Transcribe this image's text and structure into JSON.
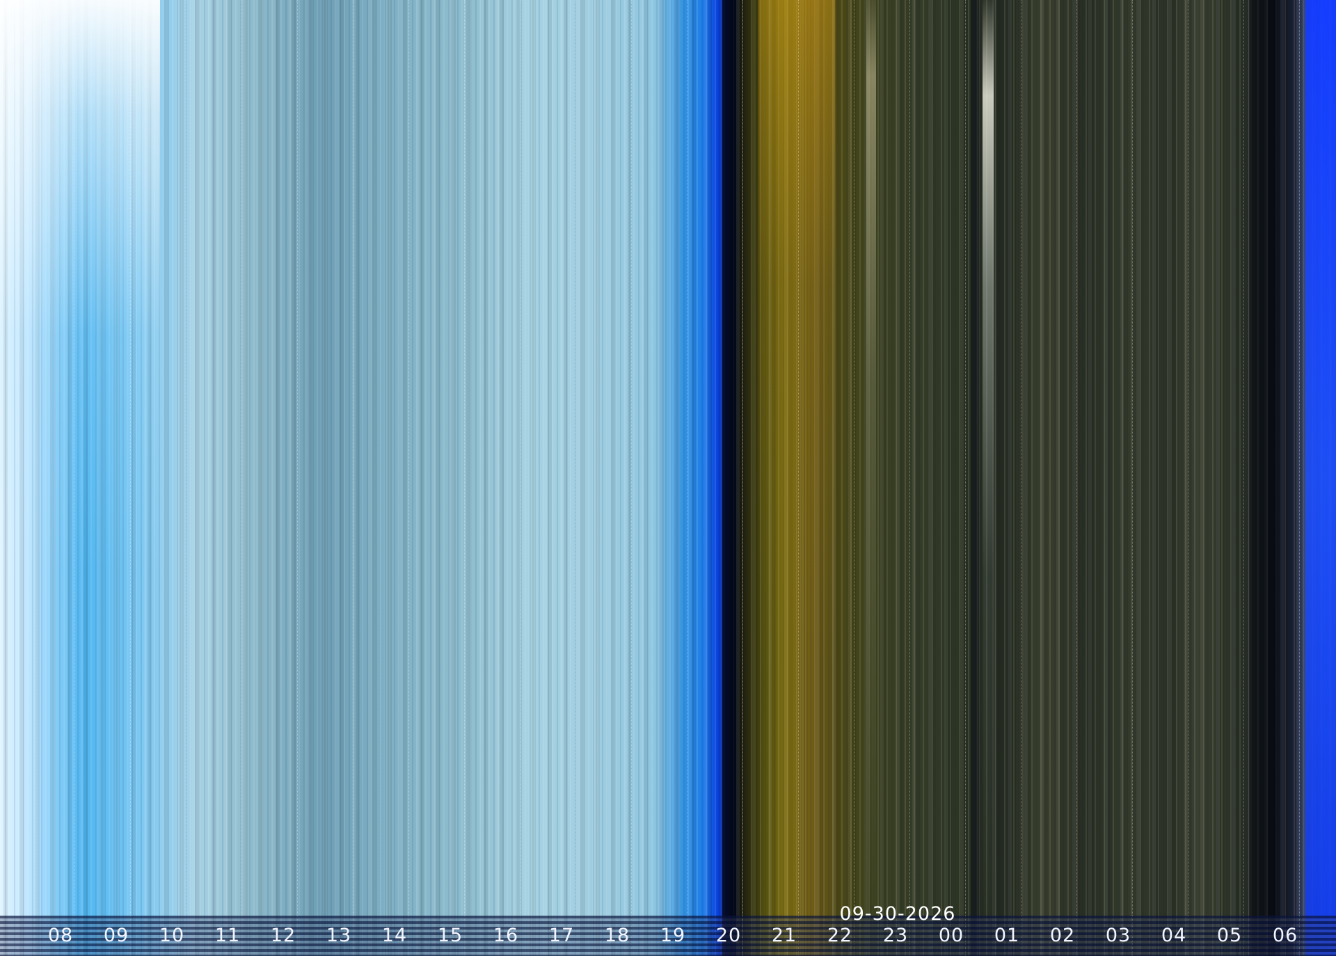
{
  "keogram": {
    "date": "09-30-2026",
    "hours": [
      "08",
      "09",
      "10",
      "11",
      "12",
      "13",
      "14",
      "15",
      "16",
      "17",
      "18",
      "19",
      "20",
      "21",
      "22",
      "23",
      "00",
      "01",
      "02",
      "03",
      "04",
      "05",
      "06"
    ]
  }
}
